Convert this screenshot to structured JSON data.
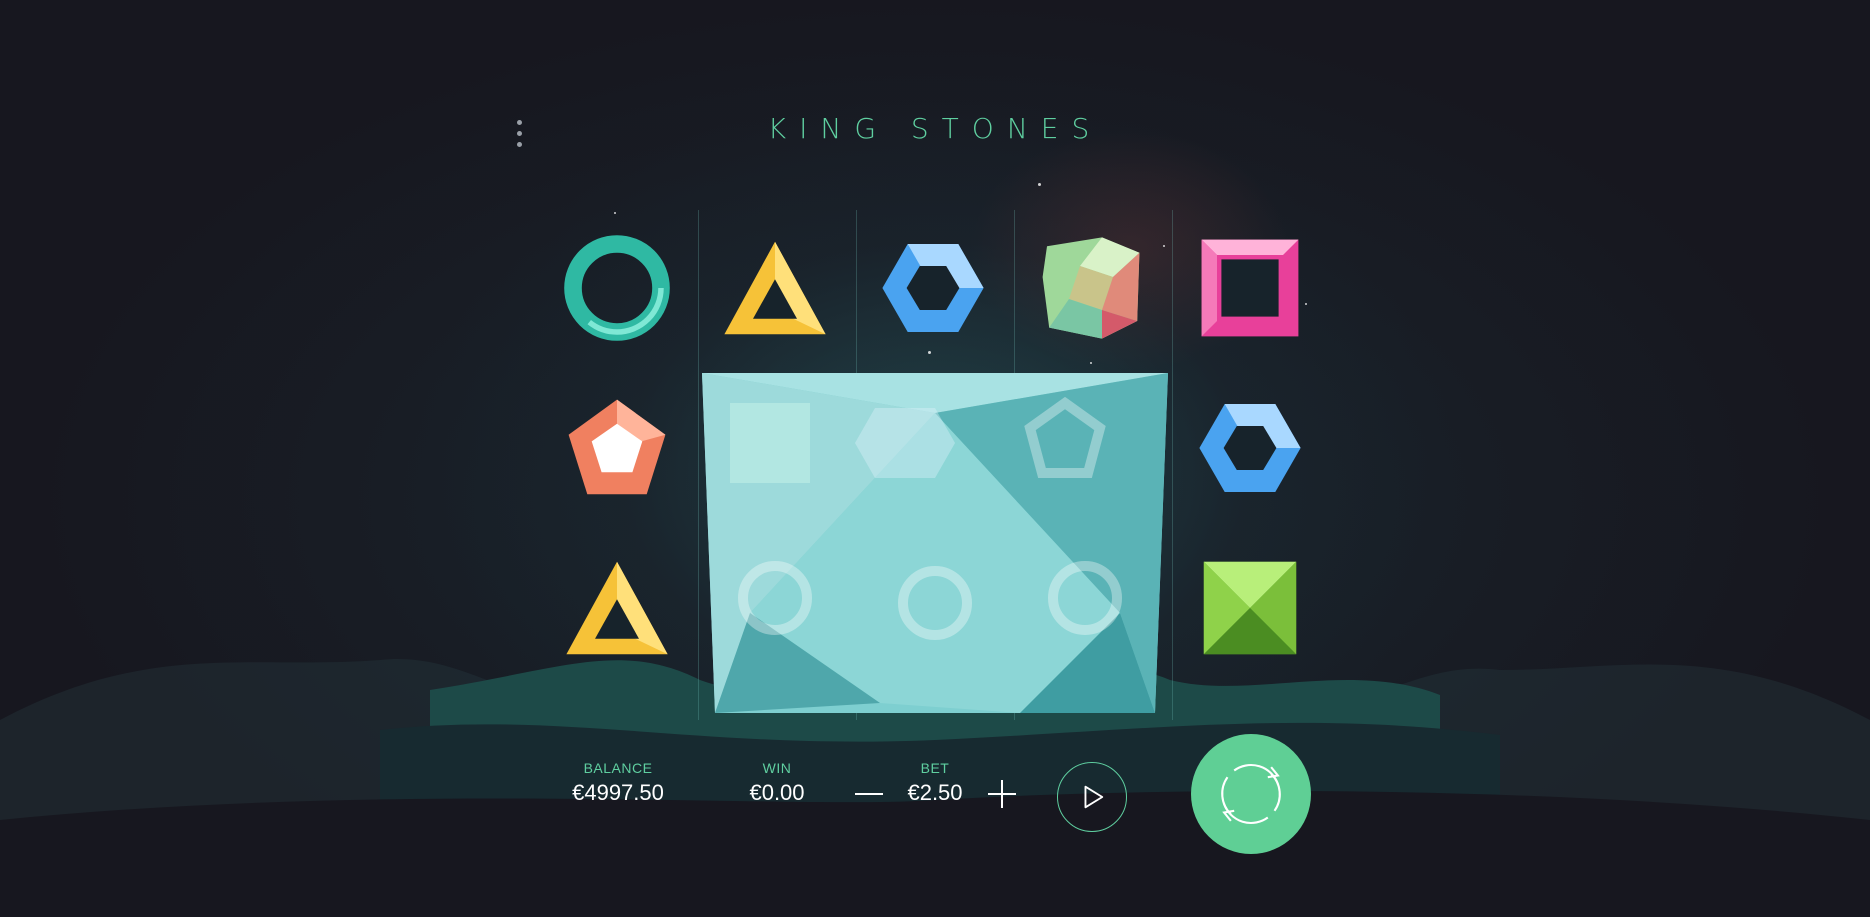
{
  "game": {
    "title": "KING STONES"
  },
  "colors": {
    "accent": "#5fcfa0",
    "spin": "#5fcf95",
    "background": "#17171f"
  },
  "reels": [
    [
      "teal-circle-gem",
      "orange-pentagon-gem",
      "yellow-triangle-gem"
    ],
    [
      "yellow-triangle-gem",
      "ice-block",
      "ice-block"
    ],
    [
      "blue-hexagon-gem",
      "ice-block",
      "ice-block"
    ],
    [
      "rainbow-crystal-gem",
      "ice-block",
      "ice-block"
    ],
    [
      "pink-square-gem",
      "blue-hexagon-gem",
      "green-octahedron-gem"
    ]
  ],
  "hud": {
    "balance_label": "BALANCE",
    "balance_value": "€4997.50",
    "win_label": "WIN",
    "win_value": "€0.00",
    "bet_label": "BET",
    "bet_value": "€2.50"
  },
  "icons": {
    "menu": "menu-dots-icon",
    "bet_decrease": "minus-icon",
    "bet_increase": "plus-icon",
    "autoplay": "play-icon",
    "spin": "refresh-icon"
  }
}
